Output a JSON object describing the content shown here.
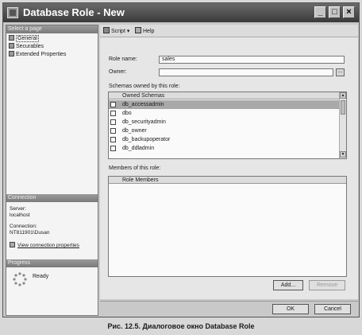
{
  "window": {
    "title": "Database Role - New"
  },
  "left_panel": {
    "select_page_header": "Select a page",
    "pages": [
      "General",
      "Securables",
      "Extended Properties"
    ],
    "connection_header": "Connection",
    "server_label": "Server:",
    "server_value": "localhost",
    "connection_label": "Connection:",
    "connection_value": "NT811901\\Dusan",
    "view_connection_link": "View connection properties",
    "progress_header": "Progress",
    "progress_status": "Ready"
  },
  "toolbar": {
    "script_label": "Script",
    "help_label": "Help"
  },
  "form": {
    "role_name_label": "Role name:",
    "role_name_value": "sales",
    "owner_label": "Owner:",
    "owner_value": "",
    "browse_label": "...",
    "schemas_label": "Schemas owned by this role:",
    "schemas_column": "Owned Schemas",
    "schemas": [
      "db_accessadmin",
      "dbo",
      "db_securityadmin",
      "db_owner",
      "db_backupoperator",
      "db_ddladmin"
    ],
    "members_label": "Members of this role:",
    "members_column": "Role Members"
  },
  "buttons": {
    "add": "Add...",
    "remove": "Remove",
    "ok": "OK",
    "cancel": "Cancel"
  },
  "caption": "Рис. 12.5. Диалоговое окно Database Role"
}
